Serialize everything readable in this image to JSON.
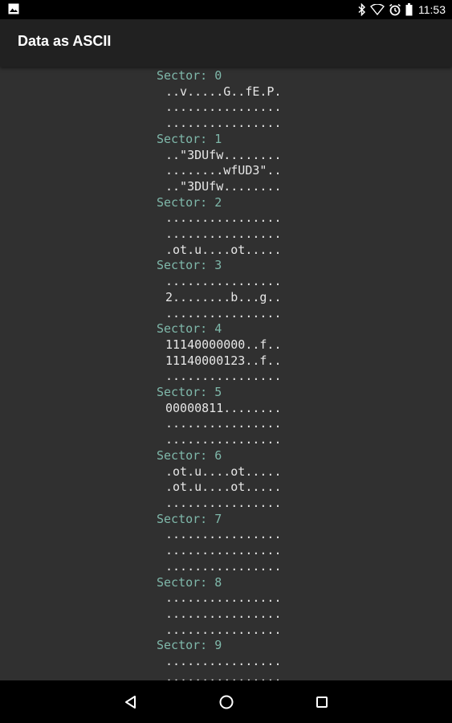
{
  "status_bar": {
    "time": "11:53",
    "icons": [
      "image-notification-icon",
      "bluetooth-icon",
      "wifi-icon",
      "alarm-icon",
      "battery-icon"
    ]
  },
  "app_bar": {
    "title": "Data as ASCII"
  },
  "sectors": [
    {
      "title": "Sector: 0",
      "lines": [
        "..v.....G..fE.P.",
        "................",
        "................"
      ]
    },
    {
      "title": "Sector: 1",
      "lines": [
        "..\"3DUfw........",
        "........wfUD3\"..",
        "..\"3DUfw........"
      ]
    },
    {
      "title": "Sector: 2",
      "lines": [
        "................",
        "................",
        ".ot.u....ot....."
      ]
    },
    {
      "title": "Sector: 3",
      "lines": [
        "................",
        "2........b...g..",
        "................"
      ]
    },
    {
      "title": "Sector: 4",
      "lines": [
        "11140000000..f..",
        "11140000123..f..",
        "................"
      ]
    },
    {
      "title": "Sector: 5",
      "lines": [
        "00000811........",
        "................",
        "................"
      ]
    },
    {
      "title": "Sector: 6",
      "lines": [
        ".ot.u....ot.....",
        ".ot.u....ot.....",
        "................"
      ]
    },
    {
      "title": "Sector: 7",
      "lines": [
        "................",
        "................",
        "................"
      ]
    },
    {
      "title": "Sector: 8",
      "lines": [
        "................",
        "................",
        "................"
      ]
    },
    {
      "title": "Sector: 9",
      "lines": [
        "................",
        "................",
        "................"
      ]
    }
  ],
  "nav_bar": {
    "icons": [
      "back-icon",
      "home-icon",
      "recents-icon"
    ]
  },
  "colors": {
    "sector_title": "#7fb8aa",
    "sector_text": "#e6e6e6",
    "background": "#303030",
    "app_bar": "#212121"
  }
}
